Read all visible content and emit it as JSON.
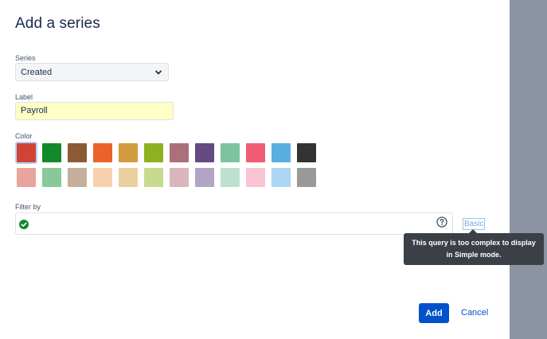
{
  "dialog": {
    "title": "Add a series"
  },
  "series": {
    "label": "Series",
    "value": "Created"
  },
  "label_field": {
    "label": "Label",
    "value": "Payroll"
  },
  "color": {
    "label": "Color",
    "selected_index": 0,
    "rows": [
      [
        "#d04437",
        "#14892c",
        "#8c5a37",
        "#ea632b",
        "#d39c3f",
        "#8eb021",
        "#ac707a",
        "#654982",
        "#7dc3a2",
        "#f15c75",
        "#59afe1",
        "#333333"
      ],
      [
        "#e8a49e",
        "#89c899",
        "#c5ae9b",
        "#f8d0ad",
        "#ebd09f",
        "#c8da8d",
        "#d9b6bc",
        "#b3a4c6",
        "#bee0d0",
        "#f8c4d2",
        "#acd6f2",
        "#999999"
      ]
    ]
  },
  "filter": {
    "label": "Filter by",
    "value": "",
    "toggle_label": "Basic"
  },
  "tooltip": {
    "line1": "This query is too complex to display",
    "line2": "in Simple mode."
  },
  "actions": {
    "add_label": "Add",
    "cancel_label": "Cancel"
  },
  "icons": {
    "status": "check-circle-icon",
    "help": "question-circle-icon",
    "select": "chevron-down-icon"
  }
}
